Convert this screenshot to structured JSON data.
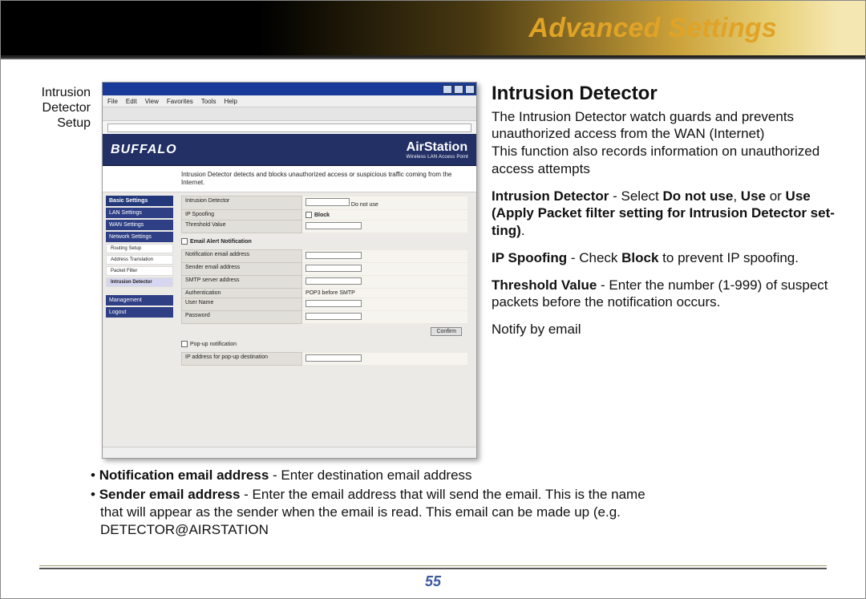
{
  "banner": {
    "title": "Advanced Settings"
  },
  "caption": {
    "line1": "Intrusion",
    "line2": "Detector",
    "line3": "Setup"
  },
  "screenshot": {
    "menubar": [
      "File",
      "Edit",
      "View",
      "Favorites",
      "Tools",
      "Help"
    ],
    "brand_left": "BUFFALO",
    "brand_right": "AirStation",
    "brand_right_sub": "Wireless LAN Access Point",
    "desc": "Intrusion Detector detects and blocks unauthorized access or suspicious traffic coming from the Internet.",
    "side": {
      "header": "Basic Settings",
      "items": [
        "LAN Settings",
        "WAN Settings",
        "Network Settings"
      ],
      "subs": [
        "Routing Setup",
        "Address Translation",
        "Packet Filter",
        "Intrusion Detector"
      ],
      "below": [
        "Management",
        "Logout"
      ]
    },
    "form": {
      "r1_label": "Intrusion Detector",
      "r1_val": "Do not use",
      "r2_label": "IP Spoofing",
      "r2_val": "Block",
      "r3_label": "Threshold Value",
      "notify_header": "Email Alert Notification",
      "r4_label": "Notification email address",
      "r5_label": "Sender email address",
      "r6_label": "SMTP server address",
      "r7_label": "Authentication",
      "r7_opts": "POP3 before SMTP",
      "r8_label": "User Name",
      "r9_label": "Password",
      "confirm": "Confirm",
      "popup_header": "Pop-up notification",
      "popup_row": "IP address for pop-up destination"
    }
  },
  "doc": {
    "h": "Intrusion Detector",
    "p1": "The Intrusion Detector watch guards and prevents unauthorized access from the WAN (Internet)",
    "p2": "This function also records information on unauthorized access attempts",
    "b_id_lead": "Intrusion Detector",
    "b_id_mid": " - Select ",
    "b_id_opts1": "Do not use",
    "b_id_sep1": ", ",
    "b_id_opts2": "Use",
    "b_id_sep2": " or ",
    "b_id_opts3": "Use (Apply Packet filter setting for Intrusion Detector set­ting)",
    "b_id_tail": ".",
    "b_ip_lead": "IP Spoofing",
    "b_ip_mid": " - Check ",
    "b_ip_bold": "Block",
    "b_ip_tail": " to prevent IP spoofing.",
    "b_th_lead": "Threshold Value",
    "b_th_tail": " - Enter the number (1-999) of suspect packets before the notification occurs.",
    "notify": "Notify by email"
  },
  "bullets": {
    "b1_lead": "Notification email address",
    "b1_tail": " - Enter destination email address",
    "b2_lead": "Sender email address",
    "b2_l1": " - Enter the email address that will send the email.  This is the name",
    "b2_l2": "that will appear as the sender when the email is read.  This email can be made up (e.g.",
    "b2_l3": "DETECTOR@AIRSTATION"
  },
  "page_number": "55"
}
